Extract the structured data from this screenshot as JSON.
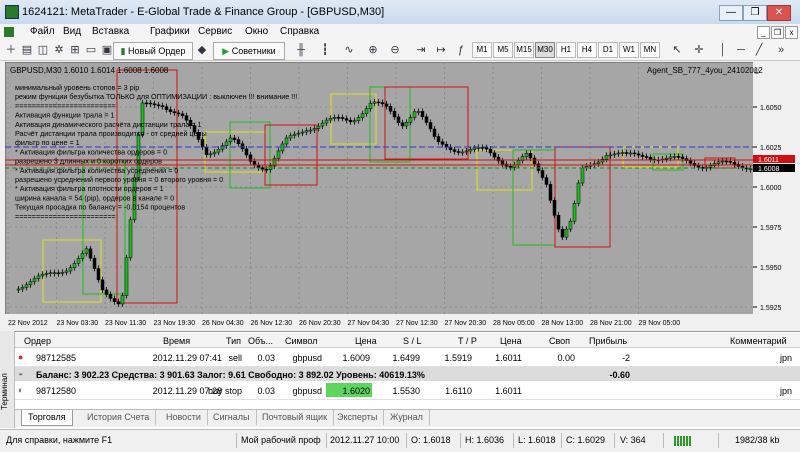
{
  "window": {
    "title": "1624121: MetaTrader - E-Global Trade & Finance Group - [GBPUSD,M30]",
    "controls": [
      "—",
      "❐",
      "✕"
    ]
  },
  "menu": {
    "items": [
      "Файл",
      "Вид",
      "Вставка",
      "Графики",
      "Сервис",
      "Окно",
      "Справка"
    ],
    "mdi_controls": [
      "_",
      "❐",
      "x"
    ]
  },
  "toolbar": {
    "new_order": "Новый Ордер",
    "advisors": "Советники",
    "timeframes": [
      "M1",
      "M5",
      "M15",
      "M30",
      "H1",
      "H4",
      "D1",
      "W1",
      "MN"
    ],
    "active_timeframe": "M30"
  },
  "chart": {
    "symbol_header": "GBPUSD,M30  1.6010 1.6014 1.6008 1.6008",
    "expert_label": "Agent_SB_777_4you_24102012",
    "background": "#a6a6a6",
    "price_ticks": [
      "1.6050",
      "1.6025",
      "1.6000",
      "1.5975",
      "1.5950",
      "1.5925"
    ],
    "current_price": "1.6008",
    "price_tags": [
      "1.6011",
      "1.6008"
    ],
    "time_ticks": [
      "22 Nov 2012",
      "23 Nov 03:30",
      "23 Nov 11:30",
      "23 Nov 19:30",
      "26 Nov 04:30",
      "26 Nov 12:30",
      "26 Nov 20:30",
      "27 Nov 04:30",
      "27 Nov 12:30",
      "27 Nov 20:30",
      "28 Nov 05:00",
      "28 Nov 13:00",
      "28 Nov 21:00",
      "29 Nov 05:00"
    ],
    "info_lines": [
      "минимальный уровень стопов =  3  pip",
      "режим функции безубытка ТОЛЬКО для ОПТИМИЗАЦИИ :  выключен  !!! внимание !!!",
      "========================",
      "Активация функции трала =  1",
      "Активация динамического расчёта дистанции трала =  1",
      "Расчёт дистанции трала производится - от средней цены",
      "фильтр по цене = 1",
      "* Активация фильтра количества ордеров =  0",
      "разрешено 3 длинных и 0 коротких ордеров",
      "* Активация фильтра количества усреднений =  0",
      "разрешено усреднений первого уровня =  0 второго уровня =  0",
      "* Активация фильтра плотности ордеров =  1",
      "ширина канала = 54 (pip), ордеров в канале =  0",
      "Текущая просадка по балансу = -0.0154 процентов",
      "========================"
    ]
  },
  "terminal": {
    "side_label": "Терминал",
    "columns": [
      "Ордер",
      "Время",
      "Тип",
      "Объ...",
      "Символ",
      "Цена",
      "S / L",
      "T / P",
      "Цена",
      "Своп",
      "Прибыль",
      "Комментарий"
    ],
    "rows": [
      {
        "order": "98712585",
        "time": "2012.11.29 07:41",
        "type": "sell",
        "volume": "0.03",
        "symbol": "gbpusd",
        "price": "1.6009",
        "sl": "1.6499",
        "tp": "1.5919",
        "cur_price": "1.6011",
        "swap": "0.00",
        "profit": "-2",
        "comment": "jpn"
      },
      {
        "order": "98712580",
        "time": "2012.11.29 07:28",
        "type": "buy stop",
        "volume": "0.03",
        "symbol": "gbpusd",
        "price": "1.6020",
        "sl": "1.5530",
        "tp": "1.6110",
        "cur_price": "1.6011",
        "swap": "",
        "profit": "",
        "comment": "jpn"
      }
    ],
    "balance_line": "Баланс: 3 902.23  Средства: 3 901.63  Залог: 9.61  Свободно: 3 892.02  Уровень: 40619.13%",
    "balance_profit": "-0.60",
    "highlight_color": "#5cd65c",
    "tabs": [
      "Торговля",
      "История Счета",
      "Новости",
      "Сигналы",
      "Почтовый ящик",
      "Эксперты",
      "Журнал"
    ],
    "active_tab": "Торговля"
  },
  "status": {
    "help": "Для справки, нажмите F1",
    "profile": "Мой рабочий проф",
    "datetime": "2012.11.27 10:00",
    "open": "O: 1.6018",
    "high": "H: 1.6036",
    "low": "L: 1.6018",
    "close": "C: 1.6029",
    "volume": "V: 364",
    "traffic": "1982/38 kb"
  }
}
